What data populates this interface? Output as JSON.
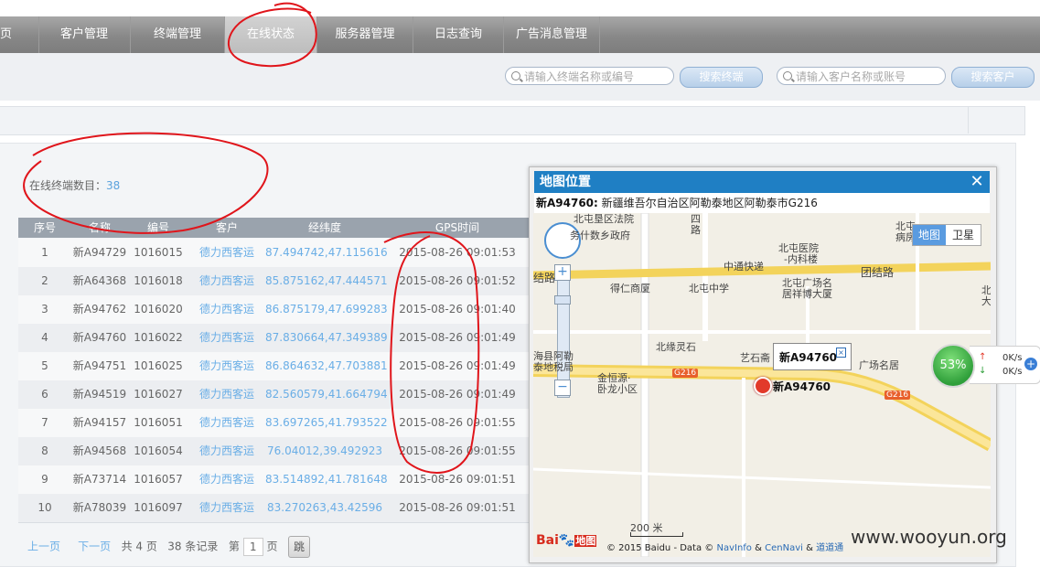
{
  "nav": {
    "items": [
      {
        "label": "页"
      },
      {
        "label": "客户管理"
      },
      {
        "label": "终端管理"
      },
      {
        "label": "在线状态"
      },
      {
        "label": "服务器管理"
      },
      {
        "label": "日志查询"
      },
      {
        "label": "广告消息管理"
      }
    ],
    "active": "在线状态"
  },
  "toolbar": {
    "terminal_search_placeholder": "请输入终端名称或编号",
    "terminal_search_button": "搜索终端",
    "customer_search_placeholder": "请输入客户名称或账号",
    "customer_search_button": "搜索客户"
  },
  "summary": {
    "label": "在线终端数目：",
    "count": "38"
  },
  "table": {
    "headers": [
      "序号",
      "名称",
      "编号",
      "客户",
      "经纬度",
      "GPS时间"
    ],
    "rows": [
      {
        "no": "1",
        "name": "新A94729",
        "id": "1016015",
        "customer": "德力西客运",
        "coords": "87.494742,47.115616",
        "time": "2015-08-26 09:01:53"
      },
      {
        "no": "2",
        "name": "新A64368",
        "id": "1016018",
        "customer": "德力西客运",
        "coords": "85.875162,47.444571",
        "time": "2015-08-26 09:01:52"
      },
      {
        "no": "3",
        "name": "新A94762",
        "id": "1016020",
        "customer": "德力西客运",
        "coords": "86.875179,47.699283",
        "time": "2015-08-26 09:01:40"
      },
      {
        "no": "4",
        "name": "新A94760",
        "id": "1016022",
        "customer": "德力西客运",
        "coords": "87.830664,47.349389",
        "time": "2015-08-26 09:01:49"
      },
      {
        "no": "5",
        "name": "新A94751",
        "id": "1016025",
        "customer": "德力西客运",
        "coords": "86.864632,47.703881",
        "time": "2015-08-26 09:01:49"
      },
      {
        "no": "6",
        "name": "新A94519",
        "id": "1016027",
        "customer": "德力西客运",
        "coords": "82.560579,41.664794",
        "time": "2015-08-26 09:01:49"
      },
      {
        "no": "7",
        "name": "新A94157",
        "id": "1016051",
        "customer": "德力西客运",
        "coords": "83.697265,41.793522",
        "time": "2015-08-26 09:01:55"
      },
      {
        "no": "8",
        "name": "新A94568",
        "id": "1016054",
        "customer": "德力西客运",
        "coords": "76.04012,39.492923",
        "time": "2015-08-26 09:01:55"
      },
      {
        "no": "9",
        "name": "新A73714",
        "id": "1016057",
        "customer": "德力西客运",
        "coords": "83.514892,41.781648",
        "time": "2015-08-26 09:01:51"
      },
      {
        "no": "10",
        "name": "新A78039",
        "id": "1016097",
        "customer": "德力西客运",
        "coords": "83.270263,43.42596",
        "time": "2015-08-26 09:01:51"
      }
    ]
  },
  "pager": {
    "prev": "上一页",
    "next": "下一页",
    "total_pages": "共 4 页",
    "total_records": "38 条记录",
    "goto_prefix": "第",
    "goto_value": "1",
    "goto_suffix": "页",
    "goto_button": "跳"
  },
  "map": {
    "title": "地图位置",
    "address_vehicle": "新A94760:",
    "address_text": "新疆维吾尔自治区阿勒泰地区阿勒泰市G216",
    "map_type_map": "地图",
    "map_type_satellite": "卫星",
    "marker_label": "新A94760",
    "popup_label": "新A94760",
    "scale": "200 米",
    "copyright_prefix": "© 2015 Baidu - Data ©",
    "copyright_navinfo": "NavInfo",
    "copyright_and1": "&",
    "copyright_cennavi": "CenNavi",
    "copyright_and2": "&",
    "copyright_daodao": "道道通",
    "logo_text": "Bai",
    "logo_text2": "地图",
    "labels": {
      "l1": "北屯垦区法院",
      "l2": "四",
      "l3": "路",
      "l4": "务什数乡政府",
      "l5": "北屯医院",
      "l6": "-内科楼",
      "l7": "中通快递",
      "l8": "结路",
      "l9": "团结路",
      "l10": "得仁商厦",
      "l11": "北屯中学",
      "l12": "北屯广场名",
      "l13": "居祥博大厦",
      "l14": "北缘灵石",
      "l15": "海县阿勒",
      "l16": "泰地税局",
      "l17": "艺石斋",
      "l18": "广场名居",
      "l19": "金恒源·",
      "l20": "卧龙小区",
      "l21": "G216",
      "l22": "G216",
      "l23": "北屯",
      "l24": "病房",
      "l25": "北",
      "l26": "大"
    }
  },
  "net": {
    "percent": "53%",
    "up": "0K/s",
    "down": "0K/s"
  },
  "watermark": "www.wooyun.org",
  "colors": {
    "map_title_bar": "#1f7fc4",
    "link": "#6aaee6",
    "annotation": "#e0151b"
  }
}
